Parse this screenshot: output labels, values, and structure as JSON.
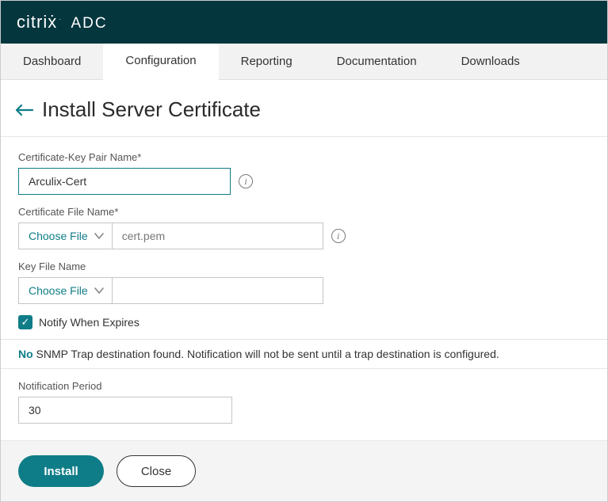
{
  "brand": {
    "name": "citriẋ",
    "dot": ".",
    "product": "ADC"
  },
  "tabs": {
    "dashboard": "Dashboard",
    "configuration": "Configuration",
    "reporting": "Reporting",
    "documentation": "Documentation",
    "downloads": "Downloads"
  },
  "page": {
    "title": "Install Server Certificate"
  },
  "form": {
    "pair_label": "Certificate-Key Pair Name*",
    "pair_value": "Arculix-Cert",
    "cert_file_label": "Certificate File Name*",
    "choose_file": "Choose File",
    "cert_file_value": "cert.pem",
    "key_file_label": "Key File Name",
    "key_file_value": "",
    "notify_label": "Notify When Expires",
    "notice_no": "No",
    "notice_text": " SNMP Trap destination found. Notification will not be sent until a trap destination is configured.",
    "period_label": "Notification Period",
    "period_value": "30"
  },
  "actions": {
    "install": "Install",
    "close": "Close"
  },
  "icons": {
    "info": "i",
    "check": "✓"
  }
}
